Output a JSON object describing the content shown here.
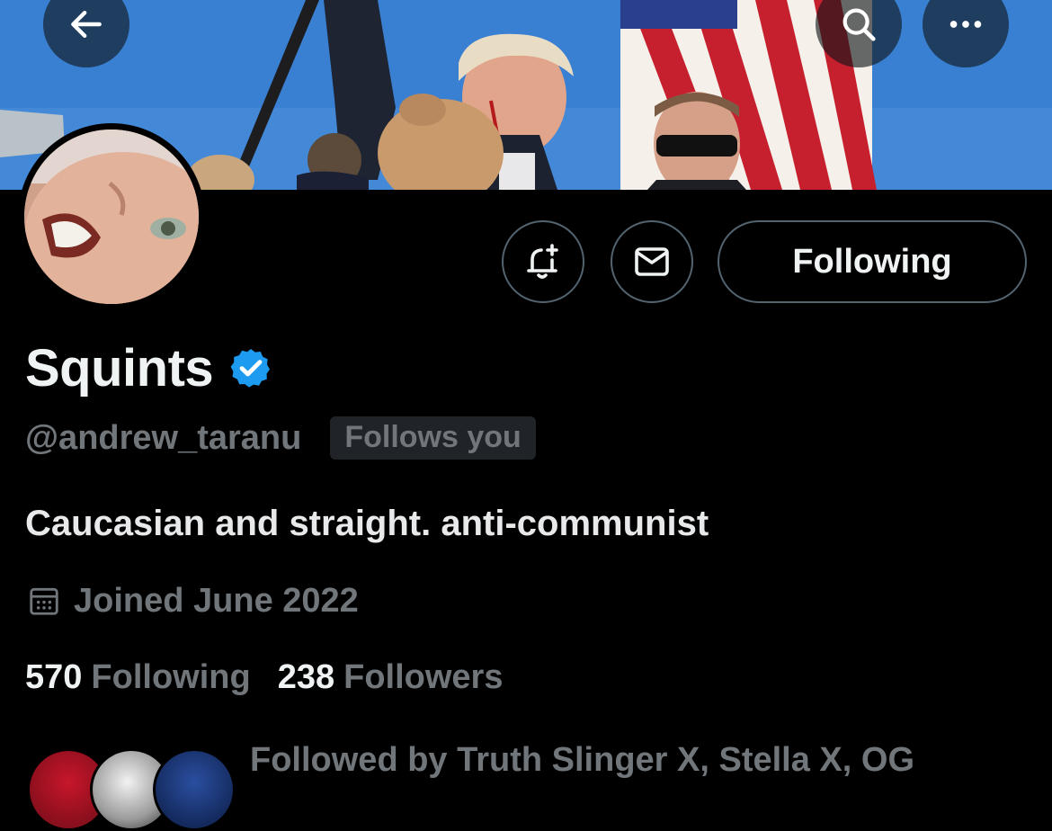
{
  "banner": {
    "description_icon": "banner-photo"
  },
  "nav": {
    "back_icon": "arrow-left-icon",
    "search_icon": "search-icon",
    "more_icon": "more-dots-icon"
  },
  "profile": {
    "display_name": "Squints",
    "verified": true,
    "handle": "@andrew_taranu",
    "follows_you": "Follows you",
    "bio": "Caucasian and straight. anti-communist",
    "joined": "Joined June 2022",
    "following_count": "570",
    "following_label": "Following",
    "followers_count": "238",
    "followers_label": "Followers",
    "followed_by": "Followed by Truth Slinger X, Stella X, OG"
  },
  "actions": {
    "notify_icon": "bell-plus-icon",
    "message_icon": "envelope-icon",
    "following_button": "Following"
  },
  "colors": {
    "background": "#000000",
    "text_primary": "#e7e9ea",
    "text_secondary": "#71767b",
    "border": "#536471",
    "verified_blue": "#1d9bf0",
    "badge_bg": "#202327"
  }
}
